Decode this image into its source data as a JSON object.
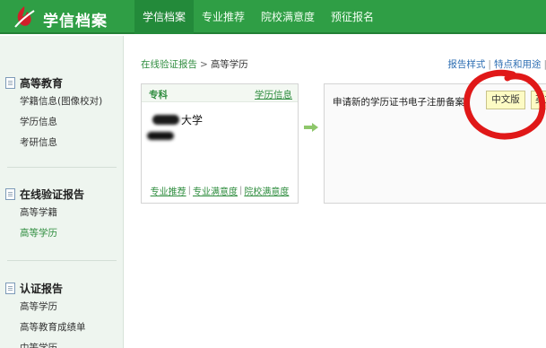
{
  "header": {
    "logo_text": "学信档案",
    "nav": [
      "学信档案",
      "专业推荐",
      "院校满意度",
      "预征报名"
    ],
    "active_index": 0
  },
  "sidebar": {
    "groups": [
      {
        "title": "高等教育",
        "items": [
          "学籍信息(图像校对)",
          "学历信息",
          "考研信息"
        ]
      },
      {
        "title": "在线验证报告",
        "items": [
          "高等学籍",
          "高等学历"
        ]
      },
      {
        "title": "认证报告",
        "items": [
          "高等学历",
          "高等教育成绩单",
          "中等学历"
        ]
      }
    ],
    "active_item": "高等学历"
  },
  "main": {
    "breadcrumb": {
      "parent": "在线验证报告",
      "separator": ">",
      "current": "高等学历"
    },
    "top_links": [
      "报告样式",
      "特点和用途"
    ],
    "card": {
      "type": "专科",
      "info_link": "学历信息",
      "school_suffix": "大学",
      "links": [
        "专业推荐",
        "专业满意度",
        "院校满意度"
      ]
    },
    "apply": {
      "text": "申请新的学历证书电子注册备案：",
      "btn_cn": "中文版",
      "btn_en": "英文版"
    }
  },
  "colors": {
    "brand_green": "#2f9e45",
    "link_green": "#2f8d3f",
    "annotation_red": "#e01818"
  }
}
